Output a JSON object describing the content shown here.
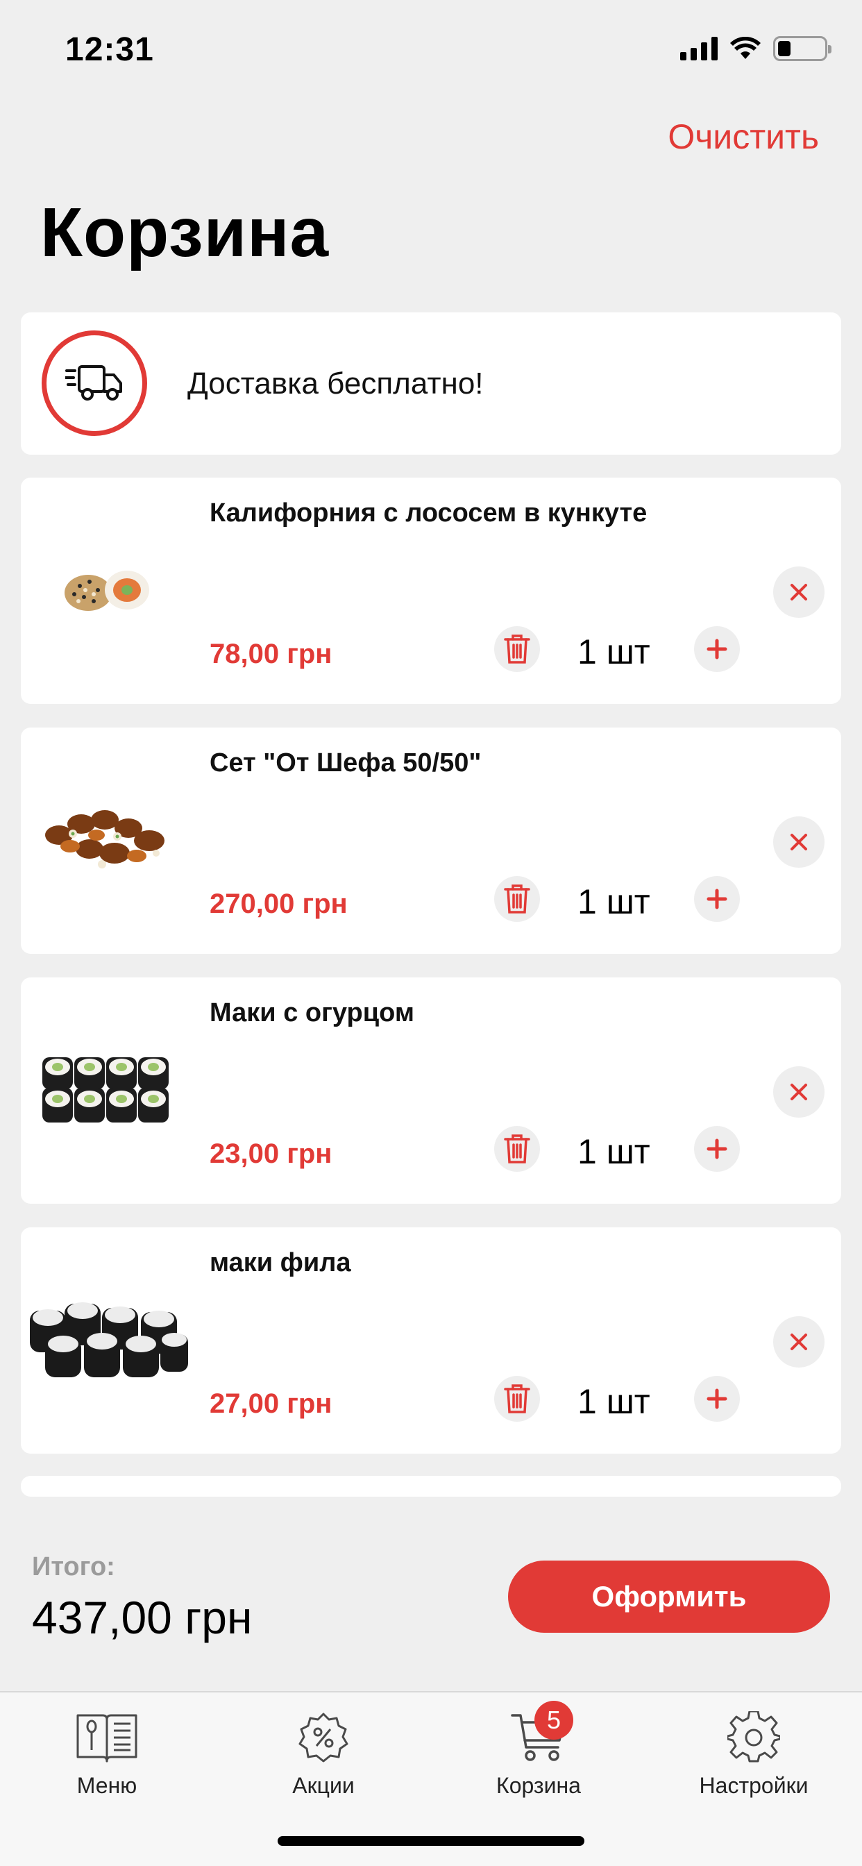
{
  "status": {
    "time": "12:31"
  },
  "header": {
    "clear_label": "Очистить",
    "title": "Корзина"
  },
  "delivery": {
    "text": "Доставка бесплатно!",
    "icon": "delivery-truck-icon"
  },
  "cart_items": [
    {
      "name": "Калифорния с лососем в кункуте",
      "price": "78,00 грн",
      "qty": "1 шт"
    },
    {
      "name": "Сет \"От Шефа 50/50\"",
      "price": "270,00 грн",
      "qty": "1 шт"
    },
    {
      "name": "Маки с огурцом",
      "price": "23,00 грн",
      "qty": "1 шт"
    },
    {
      "name": "маки фила",
      "price": "27,00 грн",
      "qty": "1 шт"
    }
  ],
  "summary": {
    "total_label": "Итого:",
    "total_value": "437,00 грн",
    "checkout_label": "Оформить"
  },
  "tabbar": {
    "tabs": [
      {
        "label": "Меню",
        "icon": "menu-book-icon"
      },
      {
        "label": "Акции",
        "icon": "discount-gear-icon"
      },
      {
        "label": "Корзина",
        "icon": "cart-icon",
        "badge": "5"
      },
      {
        "label": "Настройки",
        "icon": "settings-gear-icon"
      }
    ]
  },
  "colors": {
    "accent": "#e13a36",
    "background": "#efefef",
    "card": "#ffffff"
  }
}
